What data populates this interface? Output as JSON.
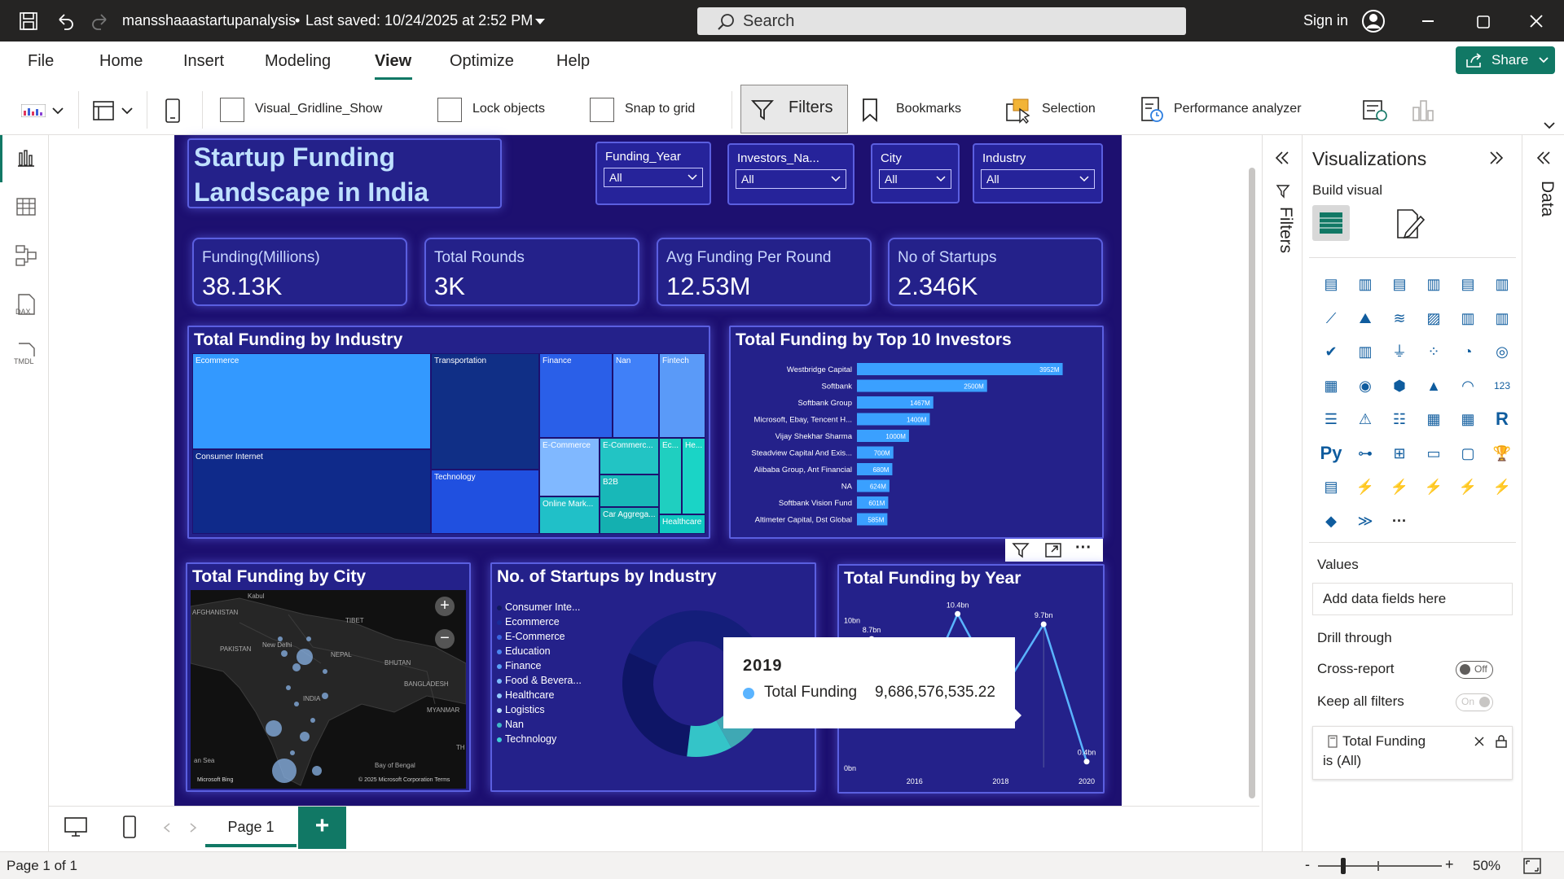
{
  "titlebar": {
    "title": "mansshaaastartupanalysis",
    "saved": "Last saved: 10/24/2025 at 2:52 PM",
    "search_placeholder": "Search",
    "signin": "Sign in"
  },
  "menu": {
    "items": [
      "File",
      "Home",
      "Insert",
      "Modeling",
      "View",
      "Optimize",
      "Help"
    ],
    "active": "View",
    "share": "Share"
  },
  "ribbon": {
    "gridline": "Visual_Gridline_Show",
    "lock": "Lock objects",
    "snap": "Snap to grid",
    "filters": "Filters",
    "bookmarks": "Bookmarks",
    "selection": "Selection",
    "performance": "Performance analyzer"
  },
  "report": {
    "title": "Startup Funding Landscape in India",
    "slicers": [
      {
        "label": "Funding_Year",
        "value": "All"
      },
      {
        "label": "Investors_Na...",
        "value": "All"
      },
      {
        "label": "City",
        "value": "All"
      },
      {
        "label": "Industry",
        "value": "All"
      }
    ],
    "kpis": [
      {
        "label": "Funding(Millions)",
        "value": "38.13K"
      },
      {
        "label": "Total Rounds",
        "value": "3K"
      },
      {
        "label": "Avg Funding Per Round",
        "value": "12.53M"
      },
      {
        "label": "No of Startups",
        "value": "2.346K"
      }
    ],
    "treemap": {
      "title": "Total Funding by Industry",
      "cells": [
        "Ecommerce",
        "Consumer Internet",
        "Transportation",
        "Technology",
        "Finance",
        "Nan",
        "Fintech",
        "E-Commerce",
        "E-Commerc...",
        "Ec...",
        "He...",
        "B2B",
        "Online Mark...",
        "Car Aggrega...",
        "Healthcare"
      ]
    },
    "map": {
      "title": "Total Funding by City",
      "labels": [
        "AFGHANISTAN",
        "Kabul",
        "TIBET",
        "PAKISTAN",
        "New Delhi",
        "NEPAL",
        "BHUTAN",
        "BANGLADESH",
        "INDIA",
        "MYANMAR",
        "Bay of Bengal",
        "an Sea",
        "TH"
      ],
      "bing": "Microsoft Bing",
      "copyright": "© 2025 Microsoft Corporation  Terms",
      "zoom_in": "+",
      "zoom_out": "−"
    },
    "donut": {
      "title": "No. of Startups by Industry",
      "legend": [
        "Consumer Inte...",
        "Ecommerce",
        "E-Commerce",
        "Education",
        "Finance",
        "Food & Bevera...",
        "Healthcare",
        "Logistics",
        "Nan",
        "Technology"
      ]
    },
    "tooltip": {
      "year": "2019",
      "measure": "Total Funding",
      "value": "9,686,576,535.22"
    },
    "visual_header": {
      "more": "···"
    }
  },
  "chart_data": [
    {
      "type": "bar",
      "title": "Total Funding by Top 10 Investors",
      "categories": [
        "Westbridge Capital",
        "Softbank",
        "Softbank Group",
        "Microsoft, Ebay, Tencent H...",
        "Vijay Shekhar Sharma",
        "Steadview Capital And Exis...",
        "Alibaba Group, Ant Financial",
        "NA",
        "Softbank Vision Fund",
        "Altimeter Capital, Dst Global"
      ],
      "values": [
        3952,
        2500,
        1467,
        1400,
        1000,
        700,
        680,
        624,
        601,
        585
      ],
      "data_labels": [
        "3952M",
        "2500M",
        "1467M",
        "1400M",
        "1000M",
        "700M",
        "680M",
        "624M",
        "601M",
        "585M"
      ],
      "xlim": [
        0,
        4100
      ],
      "orientation": "horizontal",
      "color": "#3aa0ff"
    },
    {
      "type": "line",
      "title": "Total Funding by Year",
      "x": [
        2015,
        2016,
        2017,
        2018,
        2019,
        2020
      ],
      "values": [
        8.7,
        3.8,
        10.4,
        5.0,
        9.7,
        0.4
      ],
      "data_labels": [
        "8.7bn",
        "",
        "10.4bn",
        "",
        "9.7bn",
        "0.4bn"
      ],
      "partial_label": "3.8bn",
      "ylim": [
        0,
        10.8
      ],
      "y_ticks": [
        "0bn",
        "10bn"
      ],
      "x_ticks": [
        "2016",
        "2018",
        "2020"
      ],
      "color": "#5ab4ff"
    }
  ],
  "viz_pane": {
    "title": "Visualizations",
    "build": "Build visual",
    "values": "Values",
    "add_fields": "Add data fields here",
    "drill": "Drill through",
    "cross": "Cross-report",
    "keep": "Keep all filters",
    "off": "Off",
    "on": "On",
    "filter_card_measure": "Total Funding",
    "filter_card_state": "is (All)",
    "filters_label": "Filters",
    "data_label": "Data"
  },
  "pagebar": {
    "page": "Page 1",
    "add": "+"
  },
  "status": {
    "pages": "Page 1 of 1",
    "zoom": "50%",
    "minus": "-",
    "plus": "+"
  }
}
